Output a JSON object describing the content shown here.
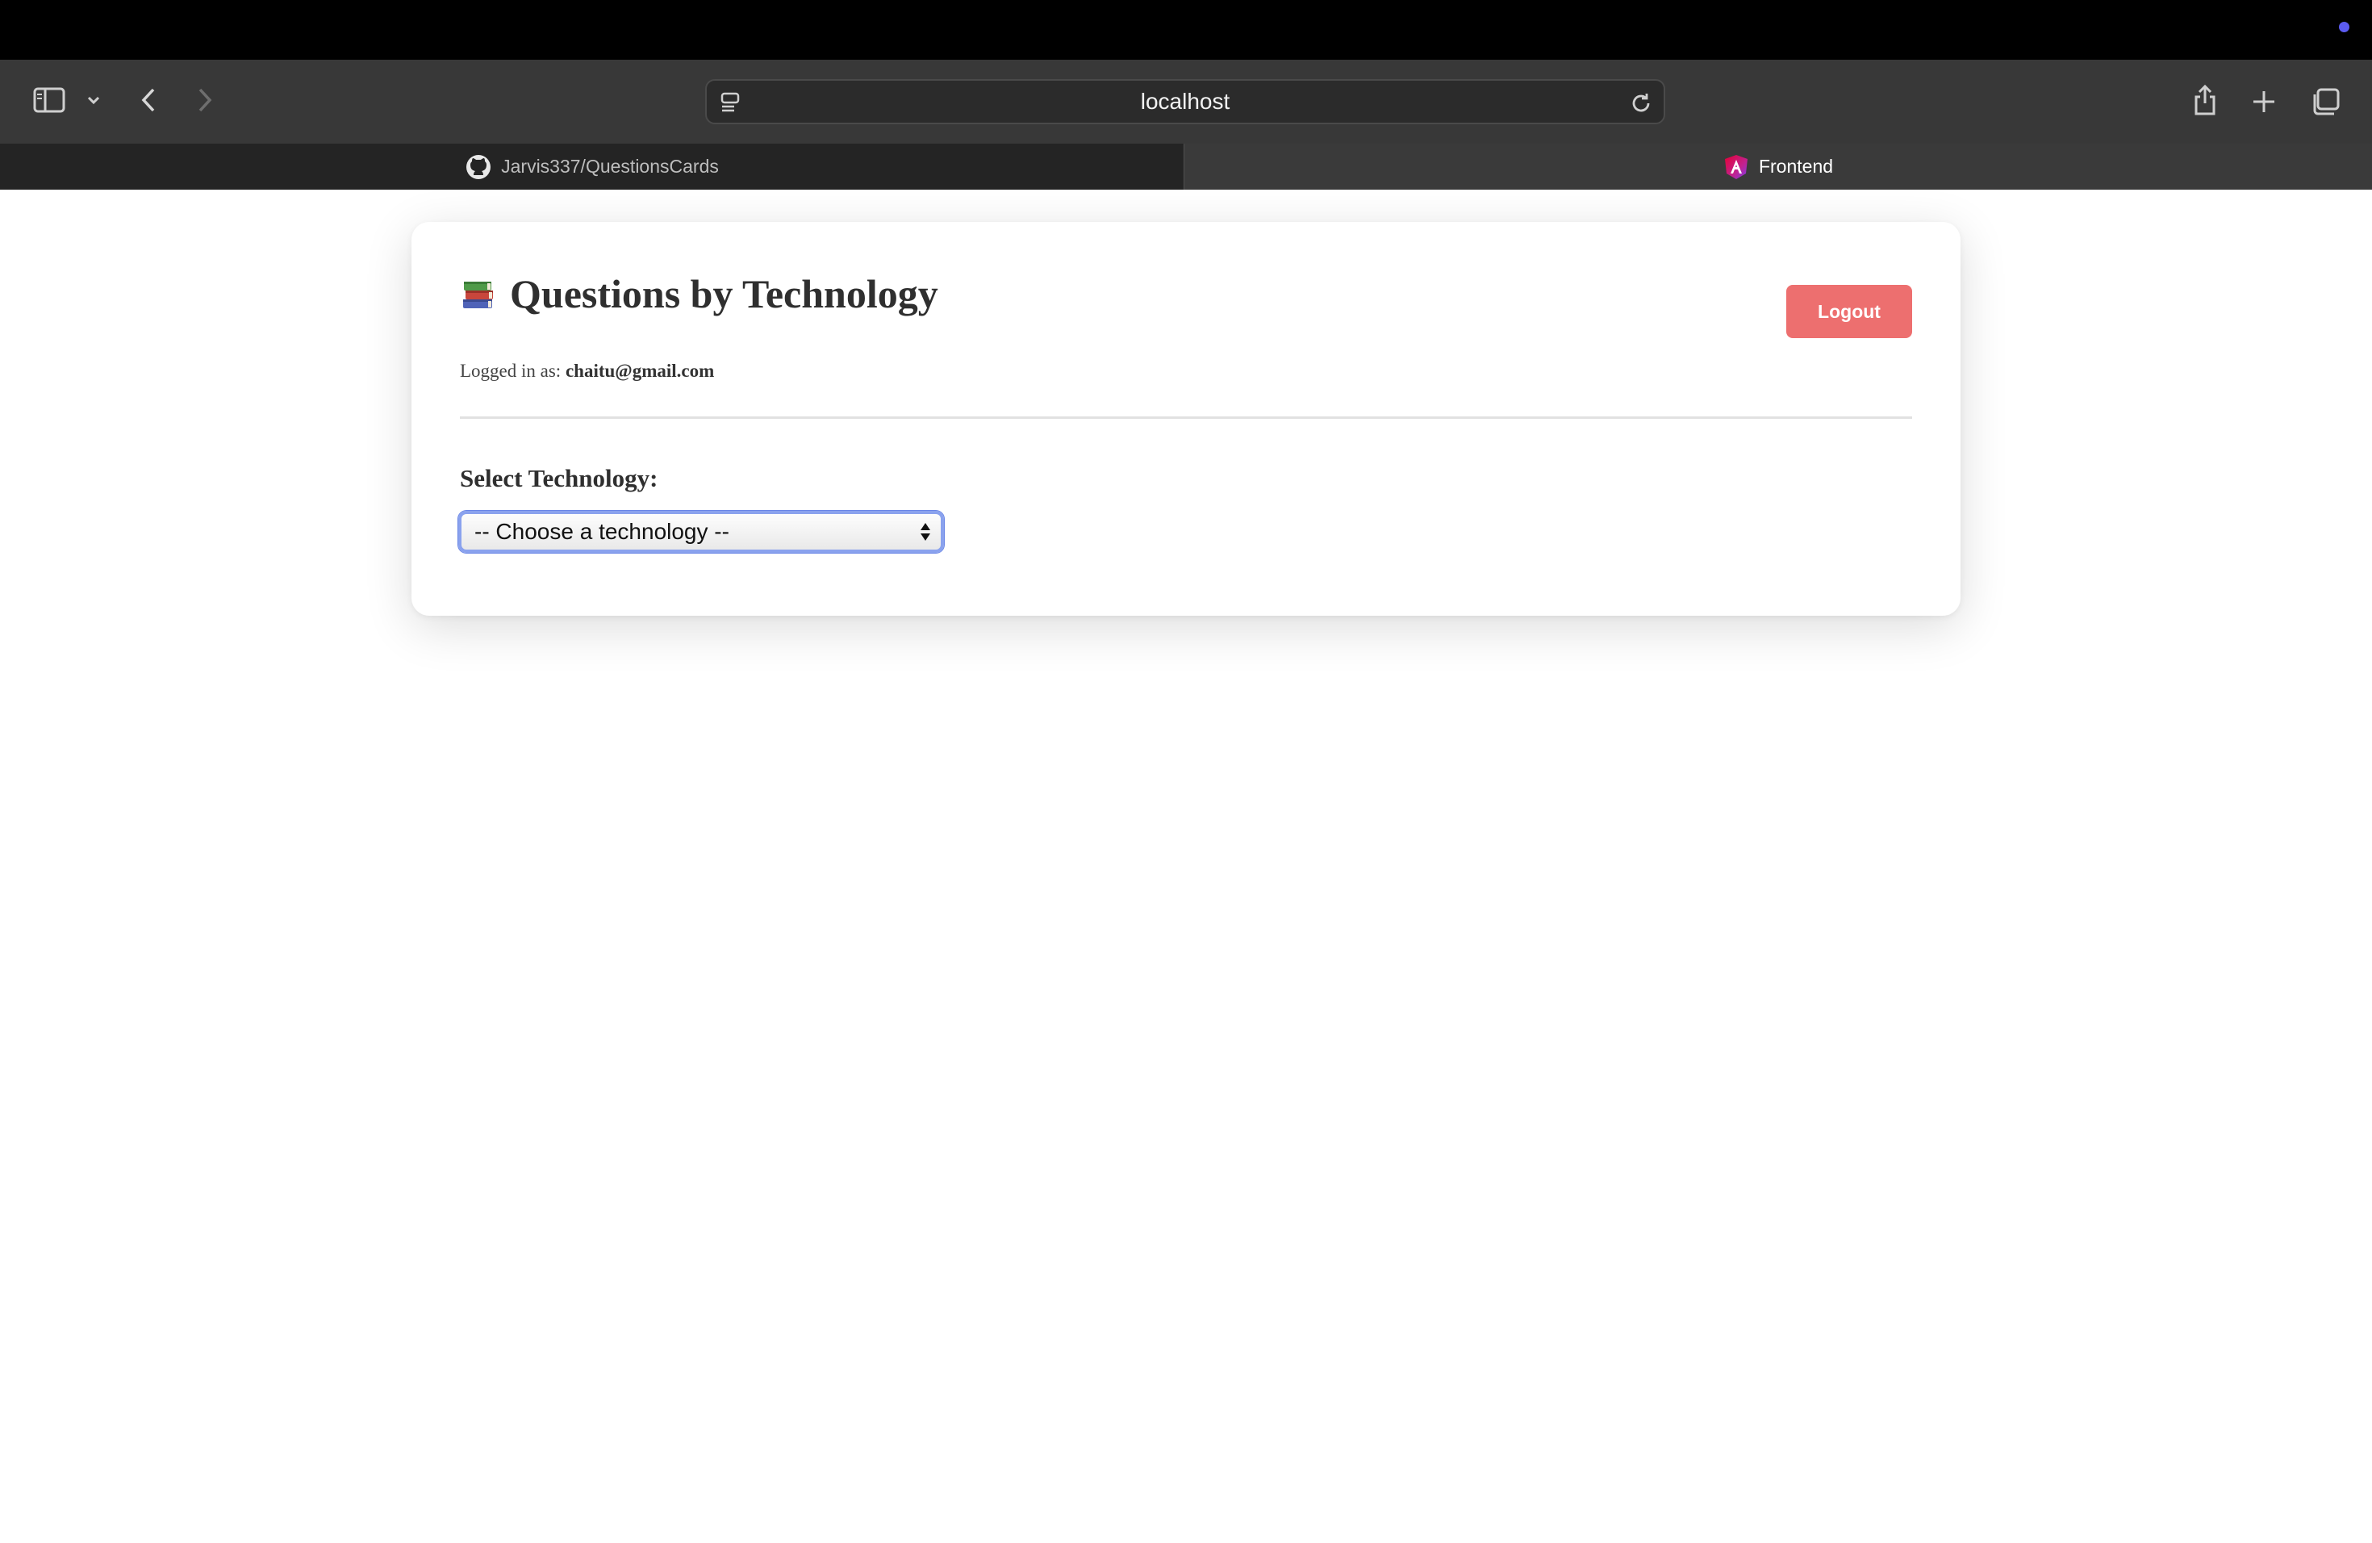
{
  "browser": {
    "address": "localhost",
    "tabs": [
      {
        "label": "Jarvis337/QuestionsCards",
        "icon": "github-icon",
        "active": false
      },
      {
        "label": "Frontend",
        "icon": "angular-icon",
        "active": true
      }
    ]
  },
  "page": {
    "title": "Questions by Technology",
    "title_icon": "books-icon",
    "logged_in_prefix": "Logged in as:",
    "user_email": "chaitu@gmail.com",
    "logout_label": "Logout",
    "select_label": "Select Technology:",
    "select_value": "-- Choose a technology --"
  },
  "colors": {
    "logout_button": "#ed6f6f",
    "select_focus_ring": "#8aa2ee",
    "toolbar_bg": "#383838",
    "active_tab_bg": "#3a3a3a"
  }
}
